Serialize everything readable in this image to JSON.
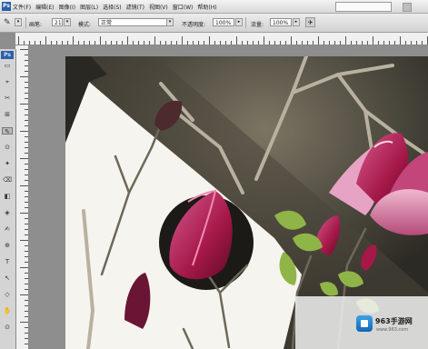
{
  "app": {
    "badge": "Ps"
  },
  "menu": {
    "items": [
      "文件(F)",
      "编辑(E)",
      "图像(I)",
      "图层(L)",
      "选择(S)",
      "滤镜(T)",
      "视图(V)",
      "窗口(W)",
      "帮助(H)"
    ]
  },
  "options": {
    "brush_label": "画笔:",
    "brush_size": "21",
    "mode_label": "模式:",
    "mode_value": "正常",
    "opacity_label": "不透明度:",
    "opacity_value": "100%",
    "flow_label": "流量:",
    "flow_value": "100%"
  },
  "icons": {
    "brush": "brush-icon",
    "airbrush": "airbrush-icon"
  },
  "toolbox": {
    "logo": "Ps",
    "tools": [
      "▭",
      "⌖",
      "✂",
      "⊞",
      "✎",
      "⊙",
      "✦",
      "⌫",
      "◧",
      "◈",
      "✍",
      "⊕",
      "T",
      "↖",
      "◇",
      "✋",
      "⊙"
    ]
  },
  "watermark": {
    "title": "963手游网",
    "subtitle": "www.963.com"
  }
}
